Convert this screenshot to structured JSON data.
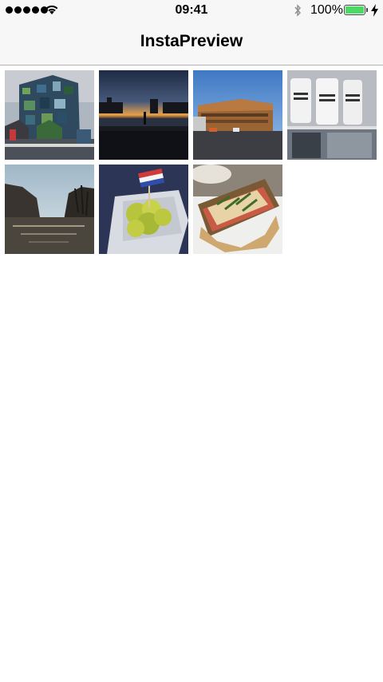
{
  "status_bar": {
    "time": "09:41",
    "battery_percent": "100%",
    "battery_level": 1.0,
    "signal_bars": 5,
    "icons": [
      "signal-icon",
      "wifi-icon",
      "bluetooth-icon",
      "battery-icon",
      "charging-icon"
    ]
  },
  "nav": {
    "title": "InstaPreview"
  },
  "photos": [
    {
      "subject": "colorful-building-photo"
    },
    {
      "subject": "sunset-waterfront-photo"
    },
    {
      "subject": "modern-building-photo"
    },
    {
      "subject": "coffee-bags-photo"
    },
    {
      "subject": "canal-photo"
    },
    {
      "subject": "herring-pickles-photo"
    },
    {
      "subject": "sandwich-photo"
    }
  ],
  "colors": {
    "bar_background": "#f7f7f7",
    "battery_green": "#4cd964",
    "divider": "#b2b2b2"
  }
}
